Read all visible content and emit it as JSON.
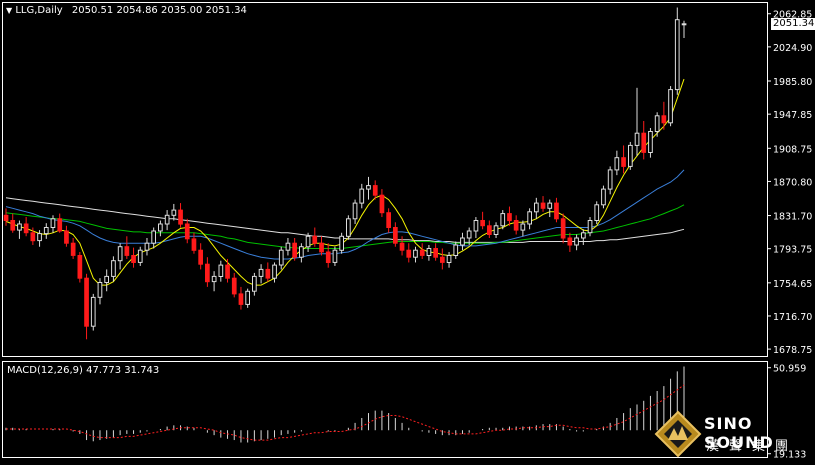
{
  "chart_data": [
    {
      "type": "candlestick",
      "header": {
        "symbol_label": "LLG,Daily",
        "ohlc_label": "2050.51 2054.86 2035.00 2051.34"
      },
      "current_price_label": "2051.34",
      "ylim": [
        1672,
        2074
      ],
      "y_ticks": [
        "2062.85",
        "2024.90",
        "1985.80",
        "1947.85",
        "1908.75",
        "1870.80",
        "1831.70",
        "1793.75",
        "1754.65",
        "1716.70",
        "1678.75"
      ],
      "y_tick_values": [
        2062.85,
        2024.9,
        1985.8,
        1947.85,
        1908.75,
        1870.8,
        1831.7,
        1793.75,
        1754.65,
        1716.7,
        1678.75
      ],
      "colors": {
        "up": "#dddddd",
        "down": "#ff1a1a",
        "ma_fast": "#f5f500",
        "ma_medium": "#3a7fd9",
        "ma_slow": "#00c000",
        "ma_long": "#e0e0e0"
      },
      "candles": [
        [
          1832,
          1840,
          1820,
          1826
        ],
        [
          1826,
          1834,
          1812,
          1815
        ],
        [
          1815,
          1826,
          1805,
          1822
        ],
        [
          1822,
          1830,
          1808,
          1812
        ],
        [
          1812,
          1818,
          1798,
          1803
        ],
        [
          1803,
          1815,
          1796,
          1811
        ],
        [
          1811,
          1823,
          1805,
          1818
        ],
        [
          1818,
          1832,
          1812,
          1828
        ],
        [
          1828,
          1834,
          1812,
          1814
        ],
        [
          1814,
          1820,
          1796,
          1800
        ],
        [
          1800,
          1806,
          1782,
          1786
        ],
        [
          1786,
          1790,
          1755,
          1760
        ],
        [
          1760,
          1765,
          1690,
          1705
        ],
        [
          1705,
          1742,
          1700,
          1738
        ],
        [
          1738,
          1760,
          1730,
          1755
        ],
        [
          1755,
          1770,
          1745,
          1762
        ],
        [
          1762,
          1785,
          1756,
          1780
        ],
        [
          1780,
          1800,
          1770,
          1796
        ],
        [
          1796,
          1808,
          1782,
          1786
        ],
        [
          1786,
          1795,
          1772,
          1778
        ],
        [
          1778,
          1796,
          1774,
          1792
        ],
        [
          1792,
          1806,
          1786,
          1800
        ],
        [
          1800,
          1818,
          1794,
          1814
        ],
        [
          1814,
          1826,
          1808,
          1822
        ],
        [
          1822,
          1838,
          1815,
          1832
        ],
        [
          1832,
          1845,
          1826,
          1838
        ],
        [
          1838,
          1846,
          1818,
          1822
        ],
        [
          1822,
          1828,
          1800,
          1805
        ],
        [
          1805,
          1812,
          1788,
          1792
        ],
        [
          1792,
          1800,
          1770,
          1776
        ],
        [
          1776,
          1784,
          1750,
          1756
        ],
        [
          1756,
          1768,
          1745,
          1762
        ],
        [
          1762,
          1780,
          1756,
          1775
        ],
        [
          1775,
          1782,
          1755,
          1760
        ],
        [
          1760,
          1766,
          1738,
          1742
        ],
        [
          1742,
          1750,
          1724,
          1730
        ],
        [
          1730,
          1748,
          1726,
          1745
        ],
        [
          1745,
          1766,
          1740,
          1762
        ],
        [
          1762,
          1776,
          1754,
          1770
        ],
        [
          1770,
          1778,
          1756,
          1760
        ],
        [
          1760,
          1778,
          1755,
          1775
        ],
        [
          1775,
          1796,
          1770,
          1792
        ],
        [
          1792,
          1806,
          1786,
          1800
        ],
        [
          1800,
          1806,
          1780,
          1784
        ],
        [
          1784,
          1800,
          1778,
          1796
        ],
        [
          1796,
          1812,
          1790,
          1808
        ],
        [
          1808,
          1818,
          1796,
          1800
        ],
        [
          1800,
          1808,
          1786,
          1790
        ],
        [
          1790,
          1800,
          1772,
          1778
        ],
        [
          1778,
          1796,
          1774,
          1792
        ],
        [
          1792,
          1812,
          1788,
          1808
        ],
        [
          1808,
          1832,
          1804,
          1828
        ],
        [
          1828,
          1850,
          1822,
          1846
        ],
        [
          1846,
          1868,
          1840,
          1862
        ],
        [
          1862,
          1876,
          1850,
          1866
        ],
        [
          1866,
          1872,
          1850,
          1855
        ],
        [
          1855,
          1862,
          1830,
          1835
        ],
        [
          1835,
          1840,
          1812,
          1818
        ],
        [
          1818,
          1824,
          1796,
          1800
        ],
        [
          1800,
          1808,
          1786,
          1792
        ],
        [
          1792,
          1800,
          1778,
          1784
        ],
        [
          1784,
          1796,
          1778,
          1792
        ],
        [
          1792,
          1800,
          1782,
          1786
        ],
        [
          1786,
          1798,
          1780,
          1794
        ],
        [
          1794,
          1800,
          1780,
          1784
        ],
        [
          1784,
          1794,
          1770,
          1778
        ],
        [
          1778,
          1790,
          1772,
          1786
        ],
        [
          1786,
          1802,
          1782,
          1798
        ],
        [
          1798,
          1812,
          1792,
          1806
        ],
        [
          1806,
          1818,
          1798,
          1814
        ],
        [
          1814,
          1830,
          1806,
          1826
        ],
        [
          1826,
          1836,
          1816,
          1820
        ],
        [
          1820,
          1826,
          1806,
          1810
        ],
        [
          1810,
          1824,
          1806,
          1820
        ],
        [
          1820,
          1838,
          1816,
          1834
        ],
        [
          1834,
          1842,
          1820,
          1826
        ],
        [
          1826,
          1832,
          1810,
          1815
        ],
        [
          1815,
          1826,
          1808,
          1822
        ],
        [
          1822,
          1840,
          1816,
          1836
        ],
        [
          1836,
          1852,
          1828,
          1846
        ],
        [
          1846,
          1854,
          1836,
          1840
        ],
        [
          1840,
          1850,
          1830,
          1846
        ],
        [
          1846,
          1852,
          1824,
          1828
        ],
        [
          1828,
          1834,
          1800,
          1806
        ],
        [
          1806,
          1812,
          1790,
          1798
        ],
        [
          1798,
          1810,
          1792,
          1806
        ],
        [
          1806,
          1816,
          1798,
          1812
        ],
        [
          1812,
          1830,
          1808,
          1826
        ],
        [
          1826,
          1848,
          1822,
          1844
        ],
        [
          1844,
          1866,
          1840,
          1862
        ],
        [
          1862,
          1888,
          1856,
          1884
        ],
        [
          1884,
          1906,
          1878,
          1898
        ],
        [
          1898,
          1912,
          1880,
          1888
        ],
        [
          1888,
          1916,
          1884,
          1912
        ],
        [
          1912,
          1978,
          1900,
          1926
        ],
        [
          1926,
          1940,
          1896,
          1904
        ],
        [
          1904,
          1932,
          1898,
          1928
        ],
        [
          1928,
          1950,
          1922,
          1946
        ],
        [
          1946,
          1962,
          1930,
          1938
        ],
        [
          1938,
          1980,
          1934,
          1976
        ],
        [
          1976,
          2070,
          1970,
          2056
        ],
        [
          2050.51,
          2054.86,
          2035.0,
          2051.34
        ]
      ],
      "ma_fast": [
        1825,
        1822,
        1819,
        1817,
        1814,
        1811,
        1810,
        1812,
        1815,
        1814,
        1810,
        1800,
        1780,
        1760,
        1752,
        1752,
        1756,
        1766,
        1776,
        1784,
        1789,
        1792,
        1795,
        1800,
        1806,
        1812,
        1817,
        1818,
        1818,
        1814,
        1806,
        1796,
        1786,
        1778,
        1770,
        1762,
        1755,
        1752,
        1752,
        1756,
        1760,
        1768,
        1778,
        1786,
        1792,
        1797,
        1800,
        1800,
        1798,
        1797,
        1799,
        1806,
        1818,
        1832,
        1844,
        1852,
        1855,
        1850,
        1840,
        1828,
        1812,
        1800,
        1793,
        1790,
        1789,
        1787,
        1786,
        1787,
        1791,
        1796,
        1803,
        1809,
        1813,
        1816,
        1818,
        1822,
        1824,
        1824,
        1825,
        1828,
        1833,
        1836,
        1836,
        1832,
        1826,
        1820,
        1815,
        1814,
        1820,
        1832,
        1848,
        1864,
        1878,
        1890,
        1900,
        1910,
        1918,
        1926,
        1934,
        1944,
        1966,
        1988
      ],
      "ma_medium": [
        1842,
        1840,
        1838,
        1836,
        1834,
        1831,
        1829,
        1827,
        1826,
        1825,
        1823,
        1820,
        1815,
        1810,
        1806,
        1803,
        1801,
        1800,
        1800,
        1800,
        1800,
        1800,
        1800,
        1801,
        1803,
        1805,
        1807,
        1808,
        1808,
        1808,
        1806,
        1803,
        1800,
        1797,
        1794,
        1791,
        1788,
        1786,
        1784,
        1783,
        1782,
        1782,
        1782,
        1783,
        1784,
        1786,
        1787,
        1788,
        1788,
        1788,
        1789,
        1790,
        1793,
        1797,
        1802,
        1806,
        1810,
        1812,
        1813,
        1813,
        1812,
        1810,
        1808,
        1806,
        1804,
        1802,
        1800,
        1798,
        1797,
        1797,
        1797,
        1798,
        1799,
        1800,
        1802,
        1804,
        1806,
        1808,
        1810,
        1812,
        1814,
        1816,
        1818,
        1818,
        1818,
        1818,
        1818,
        1818,
        1820,
        1823,
        1827,
        1832,
        1837,
        1842,
        1847,
        1852,
        1857,
        1862,
        1866,
        1870,
        1876,
        1884
      ],
      "ma_slow": [
        1835,
        1834,
        1833,
        1832,
        1831,
        1830,
        1829,
        1828,
        1828,
        1827,
        1826,
        1825,
        1823,
        1821,
        1819,
        1817,
        1816,
        1815,
        1814,
        1813,
        1813,
        1812,
        1812,
        1812,
        1812,
        1812,
        1812,
        1812,
        1812,
        1811,
        1810,
        1809,
        1808,
        1806,
        1805,
        1803,
        1801,
        1800,
        1799,
        1798,
        1797,
        1796,
        1795,
        1795,
        1794,
        1794,
        1794,
        1794,
        1794,
        1794,
        1794,
        1795,
        1796,
        1797,
        1798,
        1799,
        1800,
        1801,
        1802,
        1802,
        1802,
        1802,
        1802,
        1802,
        1801,
        1801,
        1800,
        1800,
        1800,
        1800,
        1800,
        1800,
        1800,
        1801,
        1801,
        1802,
        1803,
        1804,
        1805,
        1806,
        1807,
        1808,
        1809,
        1810,
        1810,
        1810,
        1811,
        1812,
        1813,
        1814,
        1816,
        1818,
        1820,
        1822,
        1824,
        1826,
        1828,
        1831,
        1834,
        1837,
        1840,
        1844
      ],
      "ma_long": [
        1852,
        1851,
        1850,
        1849,
        1848,
        1847,
        1846,
        1845,
        1844,
        1843,
        1842,
        1841,
        1840,
        1839,
        1838,
        1837,
        1836,
        1835,
        1834,
        1833,
        1832,
        1831,
        1830,
        1829,
        1828,
        1828,
        1827,
        1826,
        1825,
        1824,
        1823,
        1822,
        1821,
        1820,
        1819,
        1818,
        1817,
        1816,
        1815,
        1814,
        1813,
        1812,
        1812,
        1811,
        1810,
        1809,
        1808,
        1808,
        1807,
        1806,
        1806,
        1805,
        1805,
        1805,
        1805,
        1805,
        1805,
        1805,
        1804,
        1804,
        1804,
        1803,
        1803,
        1803,
        1802,
        1802,
        1802,
        1801,
        1801,
        1801,
        1801,
        1801,
        1801,
        1801,
        1801,
        1801,
        1801,
        1801,
        1802,
        1802,
        1802,
        1802,
        1802,
        1802,
        1802,
        1802,
        1802,
        1802,
        1803,
        1803,
        1804,
        1804,
        1805,
        1806,
        1807,
        1808,
        1809,
        1810,
        1811,
        1812,
        1814,
        1816
      ]
    },
    {
      "type": "bar",
      "header_label": "MACD(12,26,9) 47.773 31.743",
      "ylim": [
        -21,
        54
      ],
      "y_ticks": [
        "50.959",
        "19.133"
      ],
      "y_tick_values": [
        50.959,
        -19.133
      ],
      "colors": {
        "histogram": "#d8d8d8",
        "signal": "#ff2020"
      },
      "histogram": [
        2,
        2,
        1,
        1,
        0,
        0,
        0,
        1,
        1,
        0,
        -1,
        -3,
        -8,
        -9,
        -8,
        -7,
        -6,
        -4,
        -3,
        -3,
        -2,
        -1,
        0,
        1,
        3,
        4,
        4,
        3,
        2,
        0,
        -2,
        -4,
        -6,
        -7,
        -8,
        -10,
        -10,
        -9,
        -8,
        -7,
        -6,
        -4,
        -3,
        -2,
        -1,
        0,
        0,
        0,
        -1,
        -1,
        0,
        2,
        6,
        10,
        14,
        16,
        16,
        14,
        10,
        6,
        2,
        0,
        -1,
        -2,
        -3,
        -4,
        -4,
        -4,
        -3,
        -2,
        0,
        1,
        2,
        2,
        2,
        3,
        3,
        3,
        3,
        4,
        5,
        5,
        5,
        3,
        1,
        -1,
        -1,
        0,
        1,
        3,
        6,
        10,
        14,
        18,
        21,
        24,
        28,
        32,
        36,
        42,
        48,
        52
      ],
      "signal": [
        1,
        1,
        1,
        1,
        1,
        1,
        1,
        1,
        1,
        1,
        0,
        -1,
        -3,
        -5,
        -6,
        -6,
        -6,
        -6,
        -5,
        -5,
        -4,
        -3,
        -2,
        -1,
        0,
        1,
        2,
        2,
        2,
        2,
        1,
        0,
        -2,
        -3,
        -4,
        -6,
        -7,
        -8,
        -8,
        -8,
        -7,
        -6,
        -6,
        -5,
        -4,
        -3,
        -2,
        -2,
        -1,
        -1,
        -1,
        0,
        1,
        3,
        6,
        9,
        11,
        12,
        12,
        11,
        9,
        7,
        5,
        3,
        1,
        -1,
        -2,
        -3,
        -3,
        -3,
        -3,
        -2,
        -1,
        0,
        0,
        1,
        1,
        2,
        2,
        2,
        3,
        3,
        4,
        4,
        3,
        2,
        2,
        1,
        1,
        2,
        3,
        5,
        7,
        10,
        13,
        16,
        19,
        22,
        25,
        29,
        33,
        37
      ]
    }
  ],
  "logo": {
    "name": "SINO SOUND",
    "chinese": "漢聲集團"
  }
}
